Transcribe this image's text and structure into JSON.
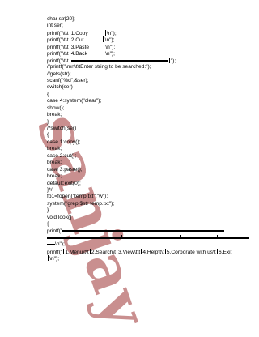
{
  "watermark": "sanjay",
  "lines": {
    "l1": "char str[20];",
    "l2": "int ser;",
    "l3a": "printf(\"\\t\\t",
    "l3b": "1.Copy",
    "l3c": "\\n\");",
    "l4a": "printf(\"\\t\\t",
    "l4b": "2.Cut",
    "l4c": "\\n\");",
    "l5a": "printf(\"\\t\\t",
    "l5b": "3.Paste",
    "l5c": "\\n\");",
    "l6a": "printf(\"\\t\\t",
    "l6b": "4.Back",
    "l6c": "\\n\");",
    "l7a": "printf(\"\\t\\t",
    "l7c": "\");",
    "l8": "//printf(\"\\n\\n\\t\\tEnter string to be searched:\");",
    "l9": "//gets(str);",
    "l10": "scanf(\"%d\",&ser);",
    "l11": "switch(ser)",
    "l12": "{",
    "l13": "case 4:system(\"clear\");",
    "l14": "show();",
    "l15": "break;",
    "l16": "}",
    "l17": "/*switch(ser)",
    "l18": "{",
    "l19": "case 1:copy();",
    "l20": "break;",
    "l21": "case 2:cut();",
    "l22": "break;",
    "l23": "case 3:paste();",
    "l24": "break;",
    "l25": "default:exit(0);",
    "l26": "}*/",
    "l27": "fp1=fopen(\"temp.txt\",\"w\");",
    "l28": "system(\"grep $str temp.txt\");",
    "l29": "}",
    "l30": "void look()",
    "l31": "{",
    "l32": "printf(\"",
    "l34": "\\n\");",
    "l35a": "printf(\"",
    "l35b": "1.Menu\\t\\t",
    "l35c": "2.Search\\t",
    "l35d": "3.View\\t\\t",
    "l35e": "4.Help\\t\\t",
    "l35f": "5.Corporate with us\\t",
    "l35g": "6.Exit",
    "l36": "\\n\");"
  }
}
